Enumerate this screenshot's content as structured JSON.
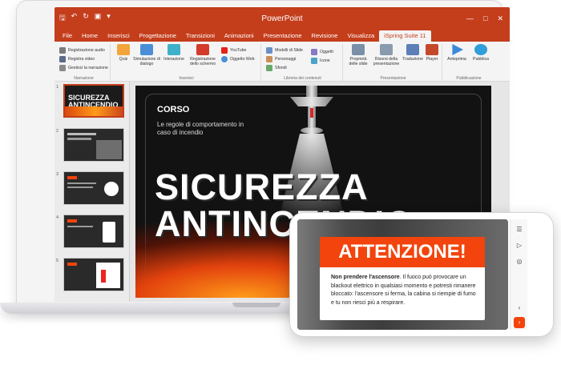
{
  "app": {
    "title": "PowerPoint",
    "qat_icons": [
      "save-icon",
      "undo-icon",
      "redo-icon",
      "slideshow-icon",
      "customize-icon"
    ]
  },
  "tabs": [
    {
      "label": "File",
      "active": false
    },
    {
      "label": "Home",
      "active": false
    },
    {
      "label": "Inserisci",
      "active": false
    },
    {
      "label": "Progettazione",
      "active": false
    },
    {
      "label": "Transizioni",
      "active": false
    },
    {
      "label": "Animazioni",
      "active": false
    },
    {
      "label": "Presentazione",
      "active": false
    },
    {
      "label": "Revisione",
      "active": false
    },
    {
      "label": "Visualizza",
      "active": false
    },
    {
      "label": "iSpring Suite 11",
      "active": true
    }
  ],
  "ribbon": {
    "narrazione": {
      "label": "Narrazione",
      "items": [
        "Registrazione audio",
        "Registra video",
        "Gestisci la narrazione"
      ]
    },
    "inserisci": {
      "label": "Inserisci",
      "buttons": [
        "Quiz",
        "Simulazione di dialogo",
        "Interazione",
        "Registrazione dello schermo"
      ],
      "list": [
        "YouTube",
        "Oggetto Web"
      ]
    },
    "libreria": {
      "label": "Libreria dei contenuti",
      "list1": [
        "Modelli di Slide",
        "Personaggi",
        "Sfondi"
      ],
      "list2": [
        "Oggetti",
        "Icone"
      ]
    },
    "presentazione": {
      "label": "Presentazione",
      "buttons": [
        "Proprietà delle slide",
        "Risorsi della presentazione",
        "Traduzione",
        "Player"
      ]
    },
    "pubblicazione": {
      "label": "Pubblicazione",
      "buttons": [
        "Anteprima",
        "Pubblica"
      ]
    }
  },
  "thumbnails": [
    "1",
    "2",
    "3",
    "4",
    "5"
  ],
  "slide": {
    "heading": "CORSO",
    "subtitle": "Le regole di comportamento in caso di incendio",
    "title_line1": "SICUREZZA",
    "title_line2": "ANTINCENDIO"
  },
  "thumb1": {
    "line1": "SICUREZZA",
    "line2": "ANTINCENDIO"
  },
  "mobile": {
    "alert_title": "ATTENZIONE!",
    "alert_bold": "Non prendere l'ascensore",
    "alert_text": ". Il fuoco può provocare un blackout elettrico in qualsiasi momento e potresti rimanere bloccato: l'ascensore si ferma, la cabina si riempie di fumo e tu non riesci più a respirare.",
    "side_icons": [
      "menu-icon",
      "play-icon",
      "replay-icon",
      "prev-icon",
      "next-icon"
    ]
  },
  "colors": {
    "accent": "#c43e1c",
    "alert": "#f2440c"
  }
}
